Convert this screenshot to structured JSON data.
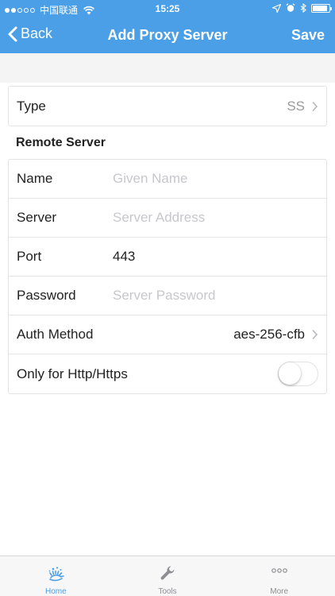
{
  "status": {
    "carrier": "中国联通",
    "time": "15:25",
    "signal_filled": 2,
    "signal_total": 5,
    "battery_level": 0.9
  },
  "nav": {
    "back_label": "Back",
    "title": "Add Proxy Server",
    "save_label": "Save"
  },
  "type_row": {
    "label": "Type",
    "value": "SS"
  },
  "section": {
    "title": "Remote Server"
  },
  "form": {
    "name": {
      "label": "Name",
      "placeholder": "Given Name",
      "value": ""
    },
    "server": {
      "label": "Server",
      "placeholder": "Server Address",
      "value": ""
    },
    "port": {
      "label": "Port",
      "placeholder": "",
      "value": "443"
    },
    "password": {
      "label": "Password",
      "placeholder": "Server Password",
      "value": ""
    },
    "auth_method": {
      "label": "Auth Method",
      "value": "aes-256-cfb"
    },
    "http_only": {
      "label": "Only for Http/Https",
      "enabled": false
    }
  },
  "tabs": [
    {
      "label": "Home",
      "icon": "home-logo-icon",
      "active": true
    },
    {
      "label": "Tools",
      "icon": "wrench-icon",
      "active": false
    },
    {
      "label": "More",
      "icon": "more-dots-icon",
      "active": false
    }
  ],
  "colors": {
    "accent": "#4a9fe6",
    "background": "#ffffff",
    "section_background": "#f4f4f4",
    "placeholder": "#c7c7cc",
    "secondary_text": "#9a9a9a"
  }
}
